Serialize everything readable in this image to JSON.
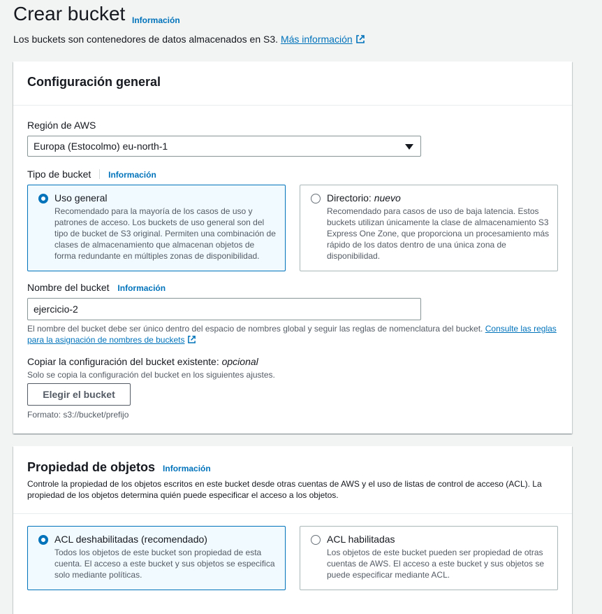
{
  "page": {
    "title": "Crear bucket",
    "title_info": "Información",
    "subtitle": "Los buckets son contenedores de datos almacenados en S3.",
    "subtitle_link": "Más información"
  },
  "general": {
    "title": "Configuración general",
    "region_label": "Región de AWS",
    "region_value": "Europa (Estocolmo) eu-north-1",
    "type_label": "Tipo de bucket",
    "type_info": "Información",
    "types": [
      {
        "title": "Uso general",
        "title_suffix": "",
        "selected": true,
        "desc": "Recomendado para la mayoría de los casos de uso y patrones de acceso. Los buckets de uso general son del tipo de bucket de S3 original. Permiten una combinación de clases de almacenamiento que almacenan objetos de forma redundante en múltiples zonas de disponibilidad."
      },
      {
        "title": "Directorio:",
        "title_suffix": "nuevo",
        "selected": false,
        "desc": "Recomendado para casos de uso de baja latencia. Estos buckets utilizan únicamente la clase de almacenamiento S3 Express One Zone, que proporciona un procesamiento más rápido de los datos dentro de una única zona de disponibilidad."
      }
    ],
    "name_label": "Nombre del bucket",
    "name_info": "Información",
    "name_value": "ejercicio-2",
    "name_hint": "El nombre del bucket debe ser único dentro del espacio de nombres global y seguir las reglas de nomenclatura del bucket.",
    "name_hint_link": "Consulte las reglas para la asignación de nombres de buckets",
    "copy_label": "Copiar la configuración del bucket existente:",
    "copy_optional": "opcional",
    "copy_hint": "Solo se copia la configuración del bucket en los siguientes ajustes.",
    "choose_button": "Elegir el bucket",
    "format_hint": "Formato: s3://bucket/prefijo"
  },
  "ownership": {
    "title": "Propiedad de objetos",
    "info": "Información",
    "desc": "Controle la propiedad de los objetos escritos en este bucket desde otras cuentas de AWS y el uso de listas de control de acceso (ACL). La propiedad de los objetos determina quién puede especificar el acceso a los objetos.",
    "options": [
      {
        "title": "ACL deshabilitadas (recomendado)",
        "selected": true,
        "desc": "Todos los objetos de este bucket son propiedad de esta cuenta. El acceso a este bucket y sus objetos se especifica solo mediante políticas."
      },
      {
        "title": "ACL habilitadas",
        "selected": false,
        "desc": "Los objetos de este bucket pueden ser propiedad de otras cuentas de AWS. El acceso a este bucket y sus objetos se puede especificar mediante ACL."
      }
    ]
  },
  "colors": {
    "accent": "#0073bb",
    "selected_bg": "#f1faff"
  }
}
